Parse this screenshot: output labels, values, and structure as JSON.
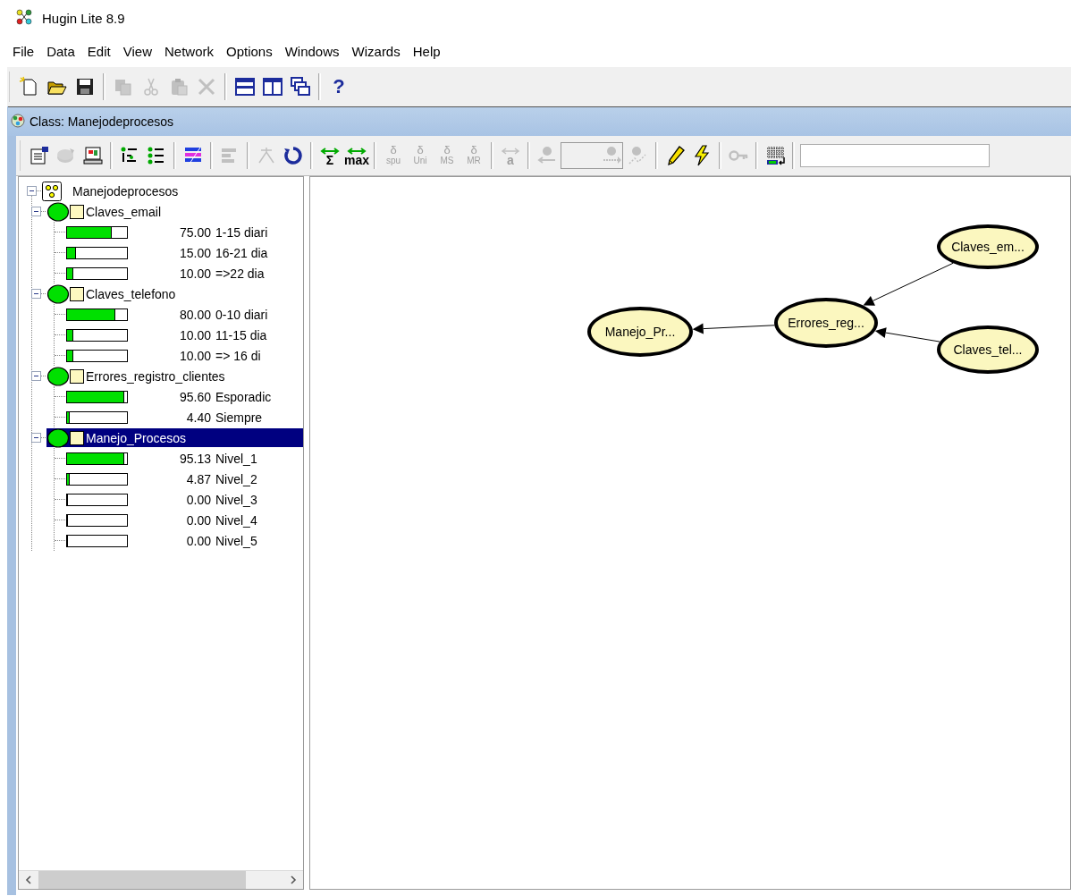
{
  "window": {
    "title": "Hugin Lite 8.9"
  },
  "menu": [
    {
      "label": "File"
    },
    {
      "label": "Data"
    },
    {
      "label": "Edit"
    },
    {
      "label": "View"
    },
    {
      "label": "Network"
    },
    {
      "label": "Options"
    },
    {
      "label": "Windows"
    },
    {
      "label": "Wizards"
    },
    {
      "label": "Help"
    }
  ],
  "main_toolbar": {
    "items": [
      {
        "kind": "button",
        "disabled": false
      },
      {
        "kind": "button",
        "disabled": false
      },
      {
        "kind": "button",
        "disabled": false
      },
      {
        "kind": "separator"
      },
      {
        "kind": "button",
        "disabled": true
      },
      {
        "kind": "button",
        "disabled": true
      },
      {
        "kind": "button",
        "disabled": true
      },
      {
        "kind": "button",
        "disabled": true
      },
      {
        "kind": "separator"
      },
      {
        "kind": "button",
        "disabled": false
      },
      {
        "kind": "button",
        "disabled": false
      },
      {
        "kind": "button",
        "disabled": false
      },
      {
        "kind": "separator"
      },
      {
        "kind": "text_button",
        "disabled": false,
        "glyph": "?"
      }
    ]
  },
  "class_window": {
    "title": "Class: Manejodeprocesos",
    "toolbar": {
      "items": [
        {
          "kind": "button",
          "disabled": false
        },
        {
          "kind": "button",
          "disabled": true
        },
        {
          "kind": "button",
          "disabled": false
        },
        {
          "kind": "separator"
        },
        {
          "kind": "button",
          "disabled": false
        },
        {
          "kind": "button",
          "disabled": false
        },
        {
          "kind": "separator"
        },
        {
          "kind": "button",
          "disabled": false
        },
        {
          "kind": "separator"
        },
        {
          "kind": "button",
          "disabled": true
        },
        {
          "kind": "separator"
        },
        {
          "kind": "button",
          "disabled": true
        },
        {
          "kind": "button",
          "disabled": false
        },
        {
          "kind": "separator"
        },
        {
          "kind": "text_button",
          "disabled": false,
          "glyph": "Σ"
        },
        {
          "kind": "text_button",
          "disabled": false,
          "glyph": "max"
        },
        {
          "kind": "separator"
        },
        {
          "kind": "delta_button",
          "disabled": true,
          "glyph": "δ",
          "sub": "spu"
        },
        {
          "kind": "delta_button",
          "disabled": true,
          "glyph": "δ",
          "sub": "Uni"
        },
        {
          "kind": "delta_button",
          "disabled": true,
          "glyph": "δ",
          "sub": "MS"
        },
        {
          "kind": "delta_button",
          "disabled": true,
          "glyph": "δ",
          "sub": "MR"
        },
        {
          "kind": "separator"
        },
        {
          "kind": "text_button",
          "disabled": true,
          "glyph": "a"
        },
        {
          "kind": "separator"
        },
        {
          "kind": "button",
          "disabled": true
        },
        {
          "kind": "box",
          "disabled": true
        },
        {
          "kind": "button",
          "disabled": true
        },
        {
          "kind": "separator"
        },
        {
          "kind": "button",
          "disabled": false
        },
        {
          "kind": "button",
          "disabled": false
        },
        {
          "kind": "separator"
        },
        {
          "kind": "button",
          "disabled": true
        },
        {
          "kind": "separator"
        },
        {
          "kind": "button",
          "disabled": false
        },
        {
          "kind": "separator"
        },
        {
          "kind": "field"
        }
      ]
    },
    "tree": {
      "label": "Manejodeprocesos",
      "expanded": true,
      "children": [
        {
          "label": "Claves_email",
          "expanded": true,
          "selected": false,
          "states": [
            {
              "percent": "75.00",
              "state": "1-15 diari",
              "level": 0.75
            },
            {
              "percent": "15.00",
              "state": "16-21 dia",
              "level": 0.15
            },
            {
              "percent": "10.00",
              "state": "=>22 dia",
              "level": 0.1
            }
          ]
        },
        {
          "label": "Claves_telefono",
          "expanded": true,
          "selected": false,
          "states": [
            {
              "percent": "80.00",
              "state": "0-10 diari",
              "level": 0.8
            },
            {
              "percent": "10.00",
              "state": "11-15 dia",
              "level": 0.1
            },
            {
              "percent": "10.00",
              "state": "=> 16 di",
              "level": 0.1
            }
          ]
        },
        {
          "label": "Errores_registro_clientes",
          "expanded": true,
          "selected": false,
          "states": [
            {
              "percent": "95.60",
              "state": "Esporadic",
              "level": 0.956
            },
            {
              "percent": "4.40",
              "state": "Siempre",
              "level": 0.044
            }
          ]
        },
        {
          "label": "Manejo_Procesos",
          "expanded": true,
          "selected": true,
          "states": [
            {
              "percent": "95.13",
              "state": "Nivel_1",
              "level": 0.9513
            },
            {
              "percent": "4.87",
              "state": "Nivel_2",
              "level": 0.0487
            },
            {
              "percent": "0.00",
              "state": "Nivel_3",
              "level": 0
            },
            {
              "percent": "0.00",
              "state": "Nivel_4",
              "level": 0
            },
            {
              "percent": "0.00",
              "state": "Nivel_5",
              "level": 0
            }
          ]
        }
      ]
    },
    "graph": {
      "nodes": [
        {
          "label": "Claves_em..."
        },
        {
          "label": "Errores_reg..."
        },
        {
          "label": "Manejo_Pr..."
        },
        {
          "label": "Claves_tel..."
        }
      ]
    }
  }
}
